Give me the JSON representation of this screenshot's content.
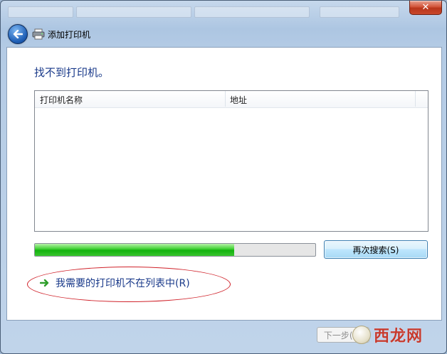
{
  "window": {
    "title": "添加打印机",
    "close_glyph": "✕"
  },
  "main": {
    "heading": "找不到打印机。",
    "columns": [
      "打印机名称",
      "地址"
    ],
    "search_progress": 0.71,
    "search_again_label": "再次搜索(S)",
    "not_listed_link": "我需要的打印机不在列表中(R)"
  },
  "footer": {
    "next_label": "下一步(N)"
  },
  "watermark": {
    "text": "西龙网"
  },
  "colors": {
    "heading": "#1a3a8a",
    "progress": "#13b20e",
    "annotation": "#d0222a"
  }
}
